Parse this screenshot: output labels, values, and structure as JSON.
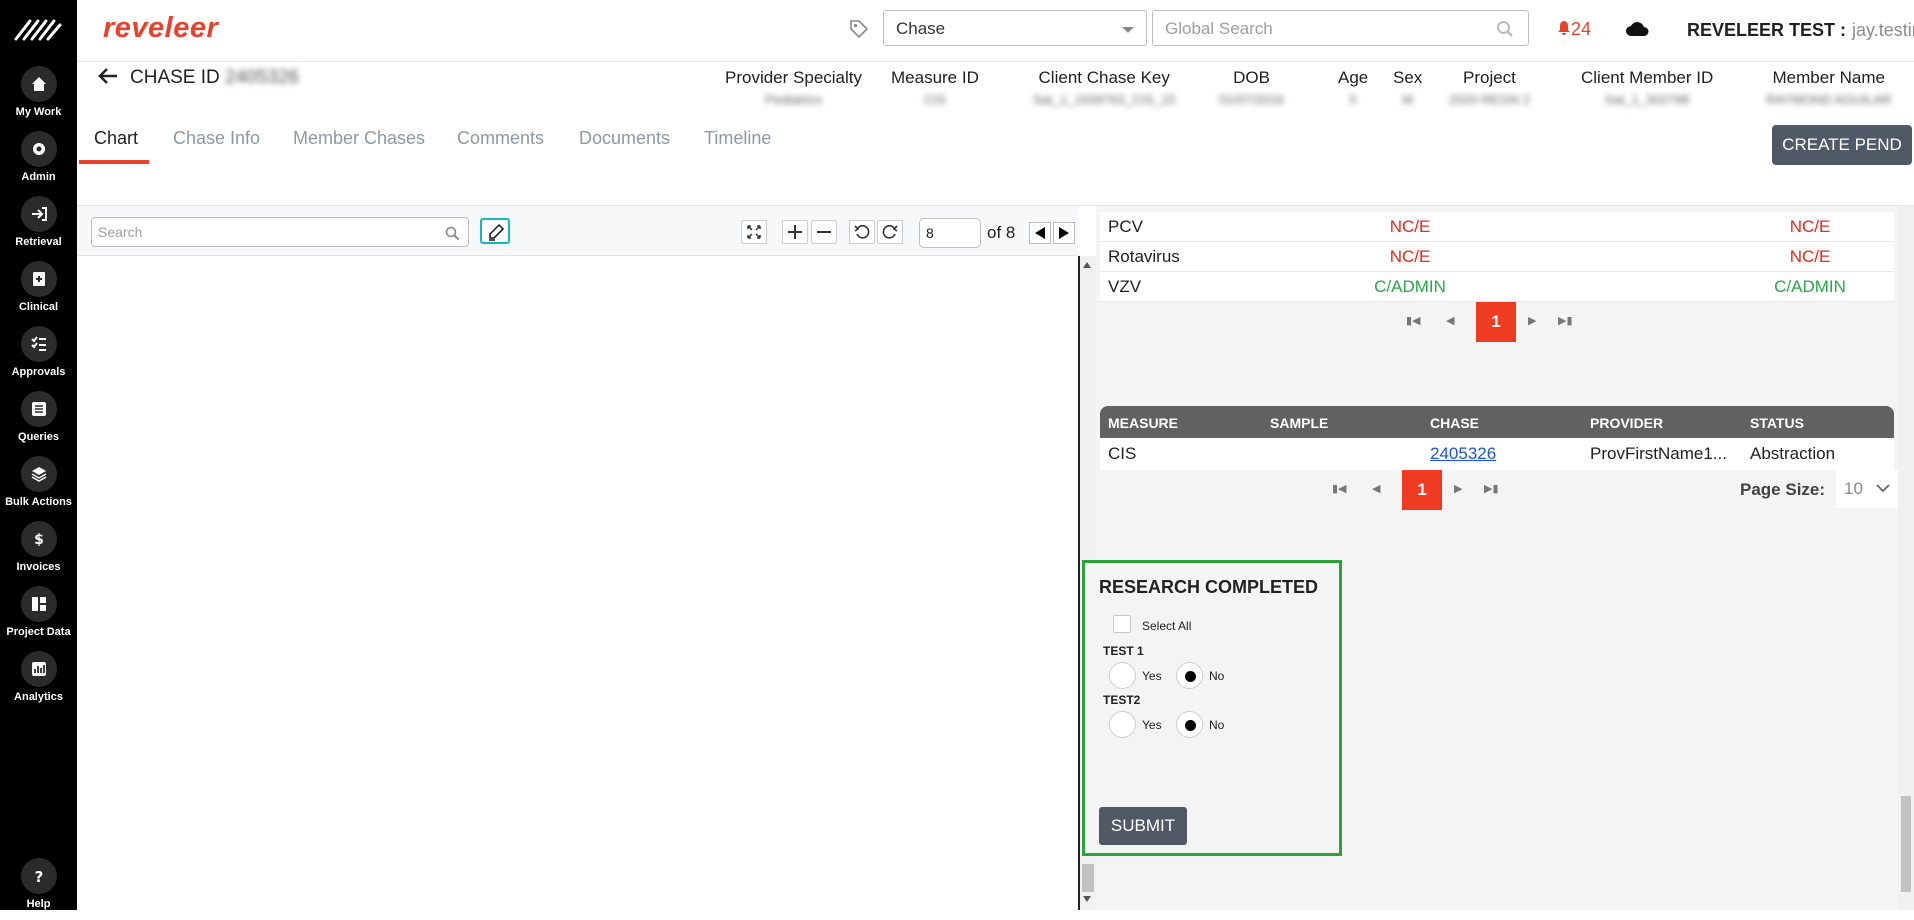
{
  "sidebar": {
    "items": [
      {
        "label": "My Work",
        "icon": "home-icon"
      },
      {
        "label": "Admin",
        "icon": "gear-icon"
      },
      {
        "label": "Retrieval",
        "icon": "arrow-in-icon"
      },
      {
        "label": "Clinical",
        "icon": "clinical-icon"
      },
      {
        "label": "Approvals",
        "icon": "checklist-icon"
      },
      {
        "label": "Queries",
        "icon": "list-icon"
      },
      {
        "label": "Bulk Actions",
        "icon": "layers-icon"
      },
      {
        "label": "Invoices",
        "icon": "dollar-icon"
      },
      {
        "label": "Project Data",
        "icon": "project-data-icon"
      },
      {
        "label": "Analytics",
        "icon": "bar-chart-icon"
      }
    ],
    "help_label": "Help"
  },
  "topbar": {
    "brand": "reveleer",
    "chase_select": "Chase",
    "search_placeholder": "Global Search",
    "notification_count": "24",
    "user_label": "REVELEER TEST :",
    "user_name": "jay.testing"
  },
  "chase": {
    "title": "CHASE ID",
    "id_value": "2405326",
    "columns": [
      {
        "label": "Provider Specialty",
        "value": "Pediatrics"
      },
      {
        "label": "Measure ID",
        "value": "CIS"
      },
      {
        "label": "Client Chase Key",
        "value": "Sat_1_1939763_CIS_15"
      },
      {
        "label": "DOB",
        "value": "01/07/2016"
      },
      {
        "label": "Age",
        "value": "5"
      },
      {
        "label": "Sex",
        "value": "M"
      },
      {
        "label": "Project",
        "value": "2020 REGN 2"
      },
      {
        "label": "Client Member ID",
        "value": "Sat_1_302798"
      },
      {
        "label": "Member Name",
        "value": "RAYMOND AGUILAR"
      }
    ]
  },
  "tabs": [
    "Chart",
    "Chase Info",
    "Member Chases",
    "Comments",
    "Documents",
    "Timeline"
  ],
  "create_pend_label": "CREATE PEND",
  "viewer": {
    "search_placeholder": "Search",
    "page_value": "8",
    "page_total": "of 8"
  },
  "immunizations": [
    {
      "name": "PCV",
      "v1": "NC/E",
      "v2": "NC/E",
      "status": "red"
    },
    {
      "name": "Rotavirus",
      "v1": "NC/E",
      "v2": "NC/E",
      "status": "red"
    },
    {
      "name": "VZV",
      "v1": "C/ADMIN",
      "v2": "C/ADMIN",
      "status": "green"
    }
  ],
  "pager1_current": "1",
  "measures": {
    "headers": [
      "MEASURE",
      "SAMPLE",
      "CHASE",
      "PROVIDER",
      "STATUS"
    ],
    "rows": [
      {
        "measure": "CIS",
        "sample": "",
        "chase": "2405326",
        "provider": "ProvFirstName1...",
        "status": "Abstraction"
      }
    ],
    "pager_current": "1",
    "page_size_label": "Page Size:",
    "page_size": "10"
  },
  "research": {
    "title": "RESEARCH COMPLETED",
    "select_all": "Select All",
    "questions": [
      {
        "label": "TEST 1",
        "yes": "Yes",
        "no": "No",
        "selected": "No"
      },
      {
        "label": "TEST2",
        "yes": "Yes",
        "no": "No",
        "selected": "No"
      }
    ],
    "submit_label": "SUBMIT"
  },
  "colors": {
    "accent": "#e8412c",
    "green_border": "#2ea23a",
    "button_dark": "#4f5a66"
  }
}
